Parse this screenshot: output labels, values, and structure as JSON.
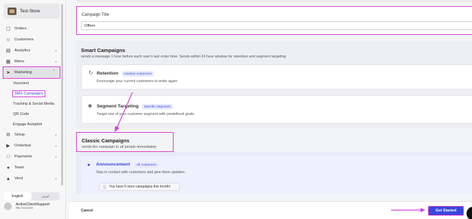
{
  "sidebar": {
    "store_name": "Test Store",
    "items": [
      {
        "label": "Orders",
        "icon": "bag-icon"
      },
      {
        "label": "Customers",
        "icon": "users-icon"
      },
      {
        "label": "Analytics",
        "icon": "chart-icon"
      },
      {
        "label": "Menu",
        "icon": "grid-icon"
      },
      {
        "label": "Marketing",
        "icon": "send-icon"
      }
    ],
    "marketing_sub": [
      "Vouchers",
      "SMS Campaigns",
      "Tracking & Social Media",
      "QR Code",
      "Engage Autopilot"
    ],
    "items_after": [
      {
        "label": "Setup",
        "icon": "gear-icon"
      },
      {
        "label": "Orderfast",
        "icon": "orderfast-icon"
      },
      {
        "label": "Payments",
        "icon": "book-icon"
      },
      {
        "label": "Team",
        "icon": "person-icon"
      },
      {
        "label": "Verd",
        "icon": "verd-icon"
      }
    ],
    "lang_en": "English",
    "lang_ar": "عربي",
    "account_name": "ActiveClientSupport",
    "account_sub": "My Account"
  },
  "form": {
    "title_label": "Campaign Title",
    "title_value": "Offers"
  },
  "smart": {
    "title": "Smart Campaigns",
    "subtitle": "sends a message 1 hour before each user's last order time. Sends within 24 hour window for retention and segment targeting",
    "cards": [
      {
        "title": "Retention",
        "badge": "Inactive customers",
        "desc": "Encourage your current customers to order again"
      },
      {
        "title": "Segment Targeting",
        "badge": "Specific segments",
        "desc": "Target one of your customer segment with predefined goals"
      }
    ]
  },
  "classic": {
    "title": "Classic Campaigns",
    "subtitle": "sends the campaign to all people immediately",
    "card": {
      "title": "Announcement",
      "badge": "All customers",
      "desc": "Stay in contact with customers and give them updates.",
      "notice": "You have 5 more campaigns this month!"
    }
  },
  "footer": {
    "cancel": "Cancel",
    "get_started": "Get Started"
  },
  "colors": {
    "highlight": "#d63bd6",
    "primary": "#3949db"
  }
}
